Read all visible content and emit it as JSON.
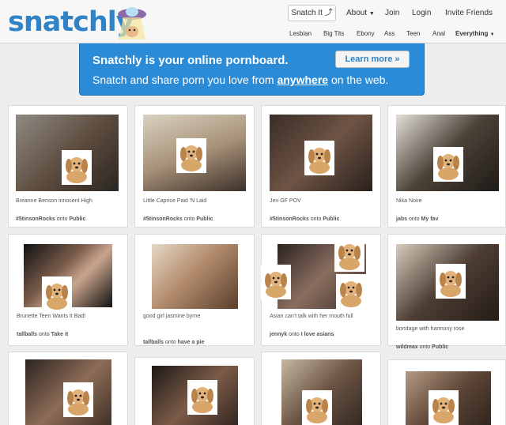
{
  "header": {
    "logo": "snatchly",
    "snatch_it": "Snatch It",
    "about": "About",
    "join": "Join",
    "login": "Login",
    "invite": "Invite Friends",
    "categories": [
      "Lesbian",
      "Big Tits",
      "Ebony",
      "Ass",
      "Teen",
      "Anal"
    ],
    "everything": "Everything"
  },
  "banner": {
    "headline": "Snatchly is your online pornboard.",
    "sub_before": "Snatch and share porn you love from ",
    "sub_em": "anywhere",
    "sub_after": " on the web.",
    "learn_more": "Learn more »"
  },
  "cards": [
    {
      "caption": "Breanne Benson innocent High",
      "user": "#5tinsonRocks",
      "onto": "onto",
      "board": "Public"
    },
    {
      "caption": "Little Caprice Paid 'N Laid",
      "user": "#5tinsonRocks",
      "onto": "onto",
      "board": "Public"
    },
    {
      "caption": "Jen GF POV",
      "user": "#5tinsonRocks",
      "onto": "onto",
      "board": "Public"
    },
    {
      "caption": "Nika Noire",
      "user": "jabs",
      "onto": "onto",
      "board": "My fav"
    },
    {
      "caption": "Brunette Teen Wants It Bad!",
      "user": "tallballs",
      "onto": "onto",
      "board": "Take it"
    },
    {
      "caption": "good girl jasmine byrne",
      "user": "tallballs",
      "onto": "onto",
      "board": "have a pie"
    },
    {
      "caption": "Asian      can't talk with her mouth full",
      "user": "jennyk",
      "onto": "onto",
      "board": "I love asians"
    },
    {
      "caption": "bondage with harmony rose",
      "user": "wildmax",
      "onto": "onto",
      "board": "Public"
    },
    {
      "caption": "",
      "user": "",
      "onto": "",
      "board": ""
    },
    {
      "caption": "",
      "user": "",
      "onto": "",
      "board": ""
    },
    {
      "caption": "",
      "user": "",
      "onto": "",
      "board": ""
    },
    {
      "caption": "",
      "user": "",
      "onto": "",
      "board": ""
    }
  ],
  "colors": {
    "brand_blue": "#2f83c6",
    "banner_blue": "#2b8bd6",
    "page_bg": "#eeeeee"
  }
}
